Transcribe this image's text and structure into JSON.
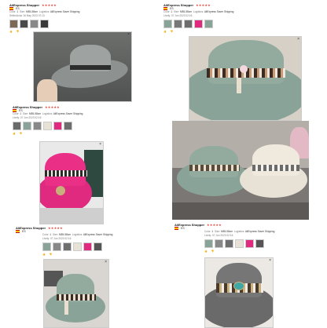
{
  "reviews": [
    {
      "name": "AliExpress Shopper",
      "stars": "★★★★★",
      "country": "ES",
      "color_label": "Color:",
      "color": "1",
      "size_label": "Size:",
      "size": "M55-58cm",
      "logistics_label": "Logistics:",
      "logistics": "AliExpress Saver Shipping",
      "date": "16 May 2023 07:13",
      "seller_label": "Seller/Actor"
    },
    {
      "name": "AliExpress Shopper",
      "stars": "★★★★★",
      "country": "ES",
      "color_label": "Color:",
      "color": "1",
      "size_label": "Size:",
      "size": "M55-58cm",
      "logistics_label": "Logistics:",
      "logistics": "AliExpress Saver Shipping",
      "date": "07 Jun 2023 02:16",
      "date_label": "Lively:"
    },
    {
      "name": "AliExpress Shopper",
      "stars": "★★★★★",
      "country": "ES",
      "color_label": "Color:",
      "color": "1",
      "size_label": "Size:",
      "size": "M55-58cm",
      "logistics_label": "Logistics:",
      "logistics": "AliExpress Saver Shipping",
      "date": "07 Jun 2023 02:16",
      "date_label": "Lively:"
    },
    {
      "name": "AliExpress Shopper",
      "stars": "★★★★★",
      "country": "ES",
      "color_label": "Color:",
      "color": "1",
      "size_label": "Size:",
      "size": "M55-58cm",
      "logistics_label": "Logistics:",
      "logistics": "AliExpress Saver Shipping",
      "date": "07 Jun 2023 02:16",
      "date_label": "Lively:"
    },
    {
      "name": "AliExpress Shopper",
      "stars": "★★★★★",
      "country": "ES",
      "color_label": "Color:",
      "color": "1",
      "size_label": "Size:",
      "size": "M55-58cm",
      "logistics_label": "Logistics:",
      "logistics": "AliExpress Saver Shipping",
      "date": "07 Jun 2023 02:16",
      "date_label": "Lively:"
    }
  ],
  "actions": {
    "like": "Like",
    "count": "0"
  },
  "colors": {
    "star": "#e8392f",
    "sage": "#8aa398",
    "grey_hat": "#6e6e6e",
    "pink_hat": "#e02a7f",
    "cream_hat": "#e8e2d6"
  },
  "icons": [
    "star-icon",
    "flag-icon",
    "like-icon",
    "dislike-icon",
    "close-icon"
  ]
}
